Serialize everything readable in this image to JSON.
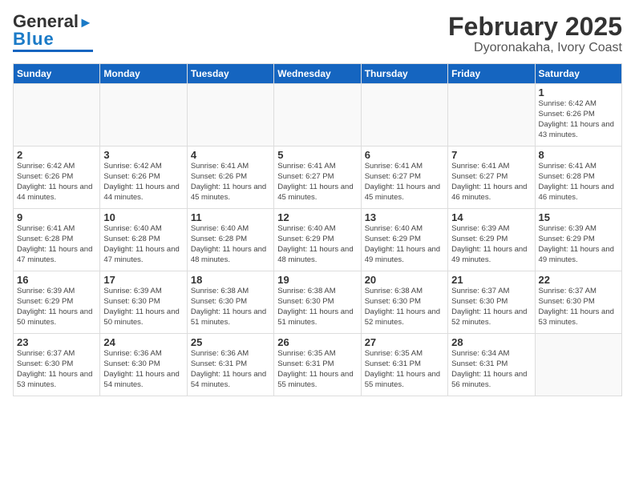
{
  "header": {
    "logo_general": "General",
    "logo_blue": "Blue",
    "title": "February 2025",
    "subtitle": "Dyoronakaha, Ivory Coast"
  },
  "days_of_week": [
    "Sunday",
    "Monday",
    "Tuesday",
    "Wednesday",
    "Thursday",
    "Friday",
    "Saturday"
  ],
  "weeks": [
    [
      {
        "day": "",
        "info": ""
      },
      {
        "day": "",
        "info": ""
      },
      {
        "day": "",
        "info": ""
      },
      {
        "day": "",
        "info": ""
      },
      {
        "day": "",
        "info": ""
      },
      {
        "day": "",
        "info": ""
      },
      {
        "day": "1",
        "info": "Sunrise: 6:42 AM\nSunset: 6:26 PM\nDaylight: 11 hours and 43 minutes."
      }
    ],
    [
      {
        "day": "2",
        "info": "Sunrise: 6:42 AM\nSunset: 6:26 PM\nDaylight: 11 hours and 44 minutes."
      },
      {
        "day": "3",
        "info": "Sunrise: 6:42 AM\nSunset: 6:26 PM\nDaylight: 11 hours and 44 minutes."
      },
      {
        "day": "4",
        "info": "Sunrise: 6:41 AM\nSunset: 6:26 PM\nDaylight: 11 hours and 45 minutes."
      },
      {
        "day": "5",
        "info": "Sunrise: 6:41 AM\nSunset: 6:27 PM\nDaylight: 11 hours and 45 minutes."
      },
      {
        "day": "6",
        "info": "Sunrise: 6:41 AM\nSunset: 6:27 PM\nDaylight: 11 hours and 45 minutes."
      },
      {
        "day": "7",
        "info": "Sunrise: 6:41 AM\nSunset: 6:27 PM\nDaylight: 11 hours and 46 minutes."
      },
      {
        "day": "8",
        "info": "Sunrise: 6:41 AM\nSunset: 6:28 PM\nDaylight: 11 hours and 46 minutes."
      }
    ],
    [
      {
        "day": "9",
        "info": "Sunrise: 6:41 AM\nSunset: 6:28 PM\nDaylight: 11 hours and 47 minutes."
      },
      {
        "day": "10",
        "info": "Sunrise: 6:40 AM\nSunset: 6:28 PM\nDaylight: 11 hours and 47 minutes."
      },
      {
        "day": "11",
        "info": "Sunrise: 6:40 AM\nSunset: 6:28 PM\nDaylight: 11 hours and 48 minutes."
      },
      {
        "day": "12",
        "info": "Sunrise: 6:40 AM\nSunset: 6:29 PM\nDaylight: 11 hours and 48 minutes."
      },
      {
        "day": "13",
        "info": "Sunrise: 6:40 AM\nSunset: 6:29 PM\nDaylight: 11 hours and 49 minutes."
      },
      {
        "day": "14",
        "info": "Sunrise: 6:39 AM\nSunset: 6:29 PM\nDaylight: 11 hours and 49 minutes."
      },
      {
        "day": "15",
        "info": "Sunrise: 6:39 AM\nSunset: 6:29 PM\nDaylight: 11 hours and 49 minutes."
      }
    ],
    [
      {
        "day": "16",
        "info": "Sunrise: 6:39 AM\nSunset: 6:29 PM\nDaylight: 11 hours and 50 minutes."
      },
      {
        "day": "17",
        "info": "Sunrise: 6:39 AM\nSunset: 6:30 PM\nDaylight: 11 hours and 50 minutes."
      },
      {
        "day": "18",
        "info": "Sunrise: 6:38 AM\nSunset: 6:30 PM\nDaylight: 11 hours and 51 minutes."
      },
      {
        "day": "19",
        "info": "Sunrise: 6:38 AM\nSunset: 6:30 PM\nDaylight: 11 hours and 51 minutes."
      },
      {
        "day": "20",
        "info": "Sunrise: 6:38 AM\nSunset: 6:30 PM\nDaylight: 11 hours and 52 minutes."
      },
      {
        "day": "21",
        "info": "Sunrise: 6:37 AM\nSunset: 6:30 PM\nDaylight: 11 hours and 52 minutes."
      },
      {
        "day": "22",
        "info": "Sunrise: 6:37 AM\nSunset: 6:30 PM\nDaylight: 11 hours and 53 minutes."
      }
    ],
    [
      {
        "day": "23",
        "info": "Sunrise: 6:37 AM\nSunset: 6:30 PM\nDaylight: 11 hours and 53 minutes."
      },
      {
        "day": "24",
        "info": "Sunrise: 6:36 AM\nSunset: 6:30 PM\nDaylight: 11 hours and 54 minutes."
      },
      {
        "day": "25",
        "info": "Sunrise: 6:36 AM\nSunset: 6:31 PM\nDaylight: 11 hours and 54 minutes."
      },
      {
        "day": "26",
        "info": "Sunrise: 6:35 AM\nSunset: 6:31 PM\nDaylight: 11 hours and 55 minutes."
      },
      {
        "day": "27",
        "info": "Sunrise: 6:35 AM\nSunset: 6:31 PM\nDaylight: 11 hours and 55 minutes."
      },
      {
        "day": "28",
        "info": "Sunrise: 6:34 AM\nSunset: 6:31 PM\nDaylight: 11 hours and 56 minutes."
      },
      {
        "day": "",
        "info": ""
      }
    ]
  ]
}
